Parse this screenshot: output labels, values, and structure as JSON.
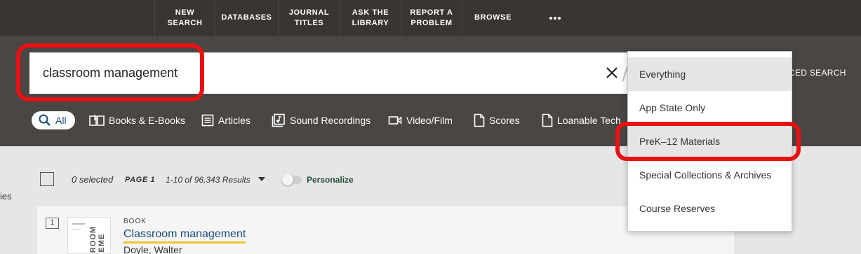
{
  "topnav": {
    "items": [
      {
        "label": "NEW\nSEARCH"
      },
      {
        "label": "DATABASES"
      },
      {
        "label": "JOURNAL\nTITLES"
      },
      {
        "label": "ASK THE\nLIBRARY"
      },
      {
        "label": "REPORT A\nPROBLEM"
      },
      {
        "label": "BROWSE"
      }
    ],
    "more_icon": "more-dots-icon"
  },
  "search": {
    "query": "classroom management",
    "advanced_label": "CED SEARCH"
  },
  "filters": [
    {
      "label": "All",
      "icon": "search-icon"
    },
    {
      "label": "Books & E-Books",
      "icon": "book-icon"
    },
    {
      "label": "Articles",
      "icon": "article-icon"
    },
    {
      "label": "Sound Recordings",
      "icon": "music-icon"
    },
    {
      "label": "Video/Film",
      "icon": "video-icon"
    },
    {
      "label": "Scores",
      "icon": "score-icon"
    },
    {
      "label": "Loanable Tech",
      "icon": "document-icon"
    }
  ],
  "scope_dropdown": {
    "options": [
      {
        "label": "Everything"
      },
      {
        "label": "App State Only"
      },
      {
        "label": "PreK–12 Materials"
      },
      {
        "label": "Special Collections & Archives"
      },
      {
        "label": "Course Reserves"
      }
    ]
  },
  "results": {
    "side_label": "ies",
    "selected_text": "0 selected",
    "page_label": "PAGE 1",
    "count_text": "1-10 of 96,343 Results",
    "personalize_label": "Personalize",
    "items": [
      {
        "number": "1",
        "type": "BOOK",
        "title": "Classroom management",
        "author": "Doyle, Walter",
        "thumb_text": "RROOM\nGEME"
      }
    ]
  },
  "colors": {
    "topbar": "#3a3533",
    "searchband": "#4a4644",
    "highlight": "#e81212",
    "link": "#1b4a7a",
    "underline": "#f2c230"
  }
}
